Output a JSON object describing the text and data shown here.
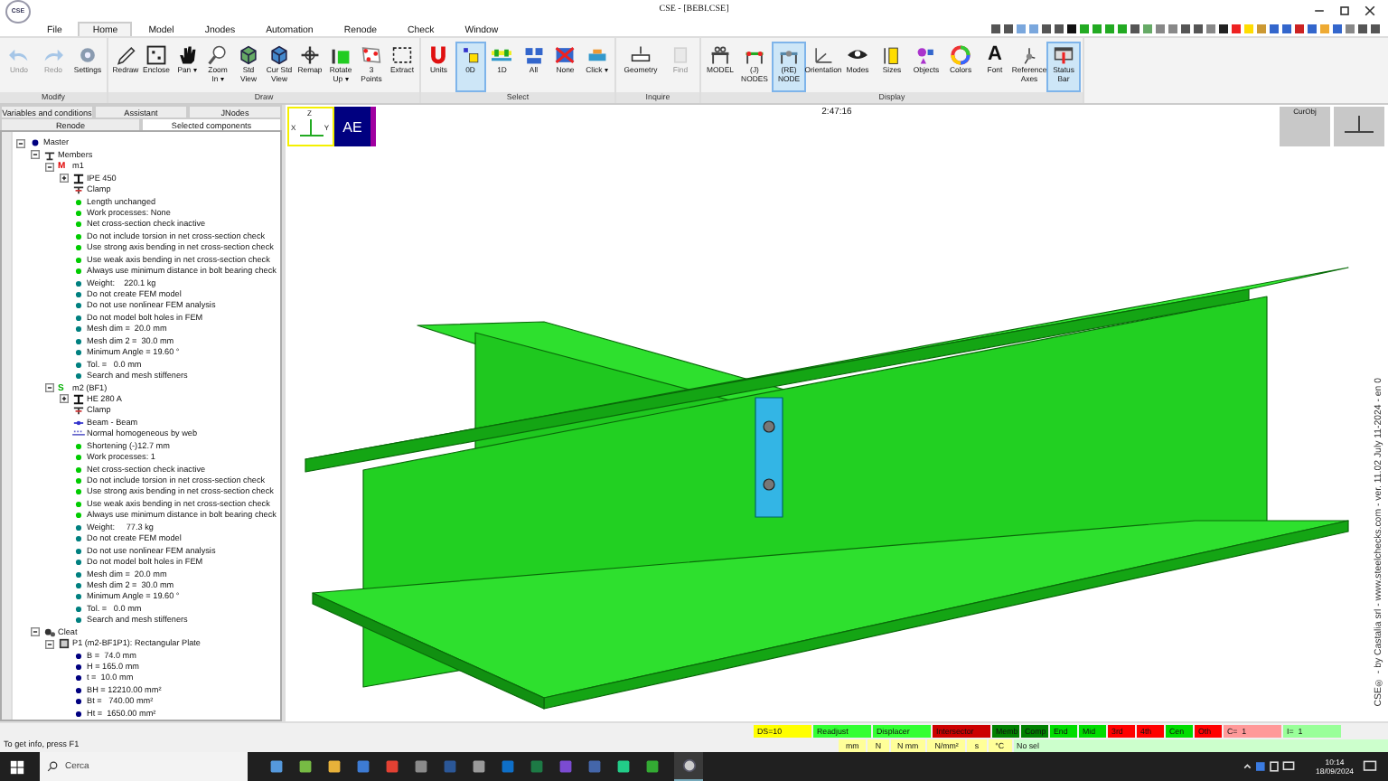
{
  "window": {
    "title": "CSE - [BEBI.CSE]",
    "logo": "CSE"
  },
  "menu_tabs": [
    {
      "label": "File",
      "selected": false
    },
    {
      "label": "Home",
      "selected": true
    },
    {
      "label": "Model",
      "selected": false
    },
    {
      "label": "Jnodes",
      "selected": false
    },
    {
      "label": "Automation",
      "selected": false
    },
    {
      "label": "Renode",
      "selected": false
    },
    {
      "label": "Check",
      "selected": false
    },
    {
      "label": "Window",
      "selected": false
    }
  ],
  "ribbon": [
    {
      "name": "Modify",
      "buttons": [
        {
          "label": "Undo",
          "selected": false,
          "disabled": true
        },
        {
          "label": "Redo",
          "selected": false,
          "disabled": true
        },
        {
          "label": "Settings",
          "selected": false,
          "disabled": false
        }
      ]
    },
    {
      "name": "Draw",
      "buttons": [
        {
          "label": "Redraw",
          "selected": false,
          "disabled": false
        },
        {
          "label": "Enclose",
          "selected": false,
          "disabled": false
        },
        {
          "label": "Pan ▾",
          "selected": false,
          "disabled": false
        },
        {
          "label": "Zoom In ▾",
          "selected": false,
          "disabled": false
        },
        {
          "label": "Std View",
          "selected": false,
          "disabled": false
        },
        {
          "label": "Cur Std View",
          "selected": false,
          "disabled": false
        },
        {
          "label": "Remap",
          "selected": false,
          "disabled": false
        },
        {
          "label": "Rotate Up ▾",
          "selected": false,
          "disabled": false
        },
        {
          "label": "3 Points",
          "selected": false,
          "disabled": false
        },
        {
          "label": "Extract",
          "selected": false,
          "disabled": false
        }
      ]
    },
    {
      "name": "Select",
      "buttons": [
        {
          "label": "Units",
          "selected": false,
          "disabled": false
        },
        {
          "label": "0D",
          "selected": true,
          "disabled": false
        },
        {
          "label": "1D",
          "selected": false,
          "disabled": false
        },
        {
          "label": "All",
          "selected": false,
          "disabled": false
        },
        {
          "label": "None",
          "selected": false,
          "disabled": false
        },
        {
          "label": "Click ▾",
          "selected": false,
          "disabled": false
        }
      ]
    },
    {
      "name": "Inquire",
      "buttons": [
        {
          "label": "Geometry",
          "selected": false,
          "disabled": false
        },
        {
          "label": "Find",
          "selected": false,
          "disabled": true
        }
      ]
    },
    {
      "name": "Display",
      "buttons": [
        {
          "label": "MODEL",
          "selected": false,
          "disabled": false
        },
        {
          "label": "(J) NODES",
          "selected": false,
          "disabled": false
        },
        {
          "label": "(RE) NODE",
          "selected": true,
          "disabled": false
        },
        {
          "label": "Orientation",
          "selected": false,
          "disabled": false
        },
        {
          "label": "Modes",
          "selected": false,
          "disabled": false
        },
        {
          "label": "Sizes",
          "selected": false,
          "disabled": false
        },
        {
          "label": "Objects",
          "selected": false,
          "disabled": false
        },
        {
          "label": "Colors",
          "selected": false,
          "disabled": false
        },
        {
          "label": "Font",
          "selected": false,
          "disabled": false,
          "glyph": "A"
        },
        {
          "label": "Reference Axes",
          "selected": false,
          "disabled": false
        },
        {
          "label": "Status Bar",
          "selected": true,
          "disabled": false
        }
      ]
    }
  ],
  "side_panel": {
    "tabs_top": [
      {
        "label": "Variables and conditions",
        "selected": false
      },
      {
        "label": "Assistant",
        "selected": false
      },
      {
        "label": "JNodes",
        "selected": false
      }
    ],
    "tabs_bottom": [
      {
        "label": "Renode",
        "selected": false
      },
      {
        "label": "Selected components",
        "selected": true
      }
    ],
    "tree": [
      {
        "label": "Master",
        "kind": "root",
        "expanded": true,
        "children": [
          {
            "label": "Members",
            "kind": "group",
            "expanded": true,
            "children": [
              {
                "label": "m1",
                "kind": "member",
                "badge": "M",
                "color": "#e00000",
                "expanded": true,
                "children": [
                  {
                    "label": "IPE 450",
                    "kind": "section",
                    "expanded": false
                  },
                  {
                    "label": "Clamp",
                    "kind": "clamp"
                  },
                  {
                    "label": "Length unchanged",
                    "kind": "dot",
                    "color": "#00cc00"
                  },
                  {
                    "label": "Work processes: None",
                    "kind": "dot",
                    "color": "#00cc00"
                  },
                  {
                    "label": "Net cross-section check inactive",
                    "kind": "dot",
                    "color": "#00cc00"
                  },
                  {
                    "label": "Do not include torsion in net cross-section check",
                    "kind": "dot",
                    "color": "#00cc00"
                  },
                  {
                    "label": "Use strong axis bending in net cross-section check",
                    "kind": "dot",
                    "color": "#00cc00"
                  },
                  {
                    "label": "Use weak axis bending in net cross-section check",
                    "kind": "dot",
                    "color": "#00cc00"
                  },
                  {
                    "label": "Always use minimum distance in bolt bearing check",
                    "kind": "dot",
                    "color": "#00cc00"
                  },
                  {
                    "label": "Weight:    220.1 kg",
                    "kind": "dot",
                    "color": "#008080"
                  },
                  {
                    "label": "Do not create FEM model",
                    "kind": "dot",
                    "color": "#008080"
                  },
                  {
                    "label": "Do not use nonlinear FEM analysis",
                    "kind": "dot",
                    "color": "#008080"
                  },
                  {
                    "label": "Do not model bolt holes in FEM",
                    "kind": "dot",
                    "color": "#008080"
                  },
                  {
                    "label": "Mesh dim =  20.0 mm",
                    "kind": "dot",
                    "color": "#008080"
                  },
                  {
                    "label": "Mesh dim 2 =  30.0 mm",
                    "kind": "dot",
                    "color": "#008080"
                  },
                  {
                    "label": "Minimum Angle = 19.60 °",
                    "kind": "dot",
                    "color": "#008080"
                  },
                  {
                    "label": "Tol. =   0.0 mm",
                    "kind": "dot",
                    "color": "#008080"
                  },
                  {
                    "label": "Search and mesh stiffeners",
                    "kind": "dot",
                    "color": "#008080"
                  }
                ]
              },
              {
                "label": "m2 (BF1)",
                "kind": "member",
                "badge": "S",
                "color": "#00b000",
                "expanded": true,
                "children": [
                  {
                    "label": "HE 280 A",
                    "kind": "section",
                    "expanded": false
                  },
                  {
                    "label": "Clamp",
                    "kind": "clamp"
                  },
                  {
                    "label": "Beam - Beam",
                    "kind": "link"
                  },
                  {
                    "label": "Normal homogeneous by web",
                    "kind": "slip"
                  },
                  {
                    "label": "Shortening (-)12.7 mm",
                    "kind": "dot",
                    "color": "#00cc00"
                  },
                  {
                    "label": "Work processes: 1",
                    "kind": "dot",
                    "color": "#00cc00"
                  },
                  {
                    "label": "Net cross-section check inactive",
                    "kind": "dot",
                    "color": "#00cc00"
                  },
                  {
                    "label": "Do not include torsion in net cross-section check",
                    "kind": "dot",
                    "color": "#00cc00"
                  },
                  {
                    "label": "Use strong axis bending in net cross-section check",
                    "kind": "dot",
                    "color": "#00cc00"
                  },
                  {
                    "label": "Use weak axis bending in net cross-section check",
                    "kind": "dot",
                    "color": "#00cc00"
                  },
                  {
                    "label": "Always use minimum distance in bolt bearing check",
                    "kind": "dot",
                    "color": "#00cc00"
                  },
                  {
                    "label": "Weight:     77.3 kg",
                    "kind": "dot",
                    "color": "#008080"
                  },
                  {
                    "label": "Do not create FEM model",
                    "kind": "dot",
                    "color": "#008080"
                  },
                  {
                    "label": "Do not use nonlinear FEM analysis",
                    "kind": "dot",
                    "color": "#008080"
                  },
                  {
                    "label": "Do not model bolt holes in FEM",
                    "kind": "dot",
                    "color": "#008080"
                  },
                  {
                    "label": "Mesh dim =  20.0 mm",
                    "kind": "dot",
                    "color": "#008080"
                  },
                  {
                    "label": "Mesh dim 2 =  30.0 mm",
                    "kind": "dot",
                    "color": "#008080"
                  },
                  {
                    "label": "Minimum Angle = 19.60 °",
                    "kind": "dot",
                    "color": "#008080"
                  },
                  {
                    "label": "Tol. =   0.0 mm",
                    "kind": "dot",
                    "color": "#008080"
                  },
                  {
                    "label": "Search and mesh stiffeners",
                    "kind": "dot",
                    "color": "#008080"
                  }
                ]
              }
            ]
          },
          {
            "label": "Cleat",
            "kind": "cleat",
            "expanded": true,
            "children": [
              {
                "label": "P1 (m2-BF1P1): Rectangular Plate",
                "kind": "plate",
                "expanded": true,
                "children": [
                  {
                    "label": "B =  74.0 mm",
                    "kind": "dot",
                    "color": "#000080"
                  },
                  {
                    "label": "H = 165.0 mm",
                    "kind": "dot",
                    "color": "#000080"
                  },
                  {
                    "label": "t =  10.0 mm",
                    "kind": "dot",
                    "color": "#000080"
                  },
                  {
                    "label": "BH = 12210.00 mm²",
                    "kind": "dot",
                    "color": "#000080"
                  },
                  {
                    "label": "Bt =   740.00 mm²",
                    "kind": "dot",
                    "color": "#000080"
                  },
                  {
                    "label": "Ht =  1650.00 mm²",
                    "kind": "dot",
                    "color": "#000080"
                  }
                ]
              }
            ]
          }
        ]
      }
    ]
  },
  "canvas": {
    "time": "2:47:16",
    "triad": {
      "x": "X",
      "y": "Y",
      "z": "Z"
    },
    "view_badge": "AE",
    "cur_obj": "CurObj",
    "version": "CSE® - by Castalia srl - www.steelchecks.com - ver. 11.02 July 11-2024 - en 0"
  },
  "status_bar": {
    "hint": "To get info, press F1",
    "flags": [
      {
        "label": "DS=10",
        "color": "#ffff00"
      },
      {
        "label": "Readjust",
        "color": "#33ff33"
      },
      {
        "label": "Displacer",
        "color": "#33ff33"
      },
      {
        "label": "Intersector",
        "color": "#cc0000"
      },
      {
        "label": "Memb",
        "color": "#008000"
      },
      {
        "label": "Comp",
        "color": "#008000"
      },
      {
        "label": "End",
        "color": "#00dd00"
      },
      {
        "label": "Mid",
        "color": "#00dd00"
      },
      {
        "label": "3rd",
        "color": "#ff0000"
      },
      {
        "label": "4th",
        "color": "#ff0000"
      },
      {
        "label": "Cen",
        "color": "#00dd00"
      },
      {
        "label": "Oth",
        "color": "#ff0000"
      },
      {
        "label": "C=  1",
        "color": "#ff9999"
      },
      {
        "label": "I=  1",
        "color": "#99ff99"
      }
    ],
    "units": [
      "mm",
      "N",
      "N mm",
      "N/mm²",
      "s",
      "°C"
    ],
    "selection": "No sel"
  },
  "taskbar": {
    "search_placeholder": "Cerca",
    "time": "10:14",
    "date": "18/09/2024"
  }
}
